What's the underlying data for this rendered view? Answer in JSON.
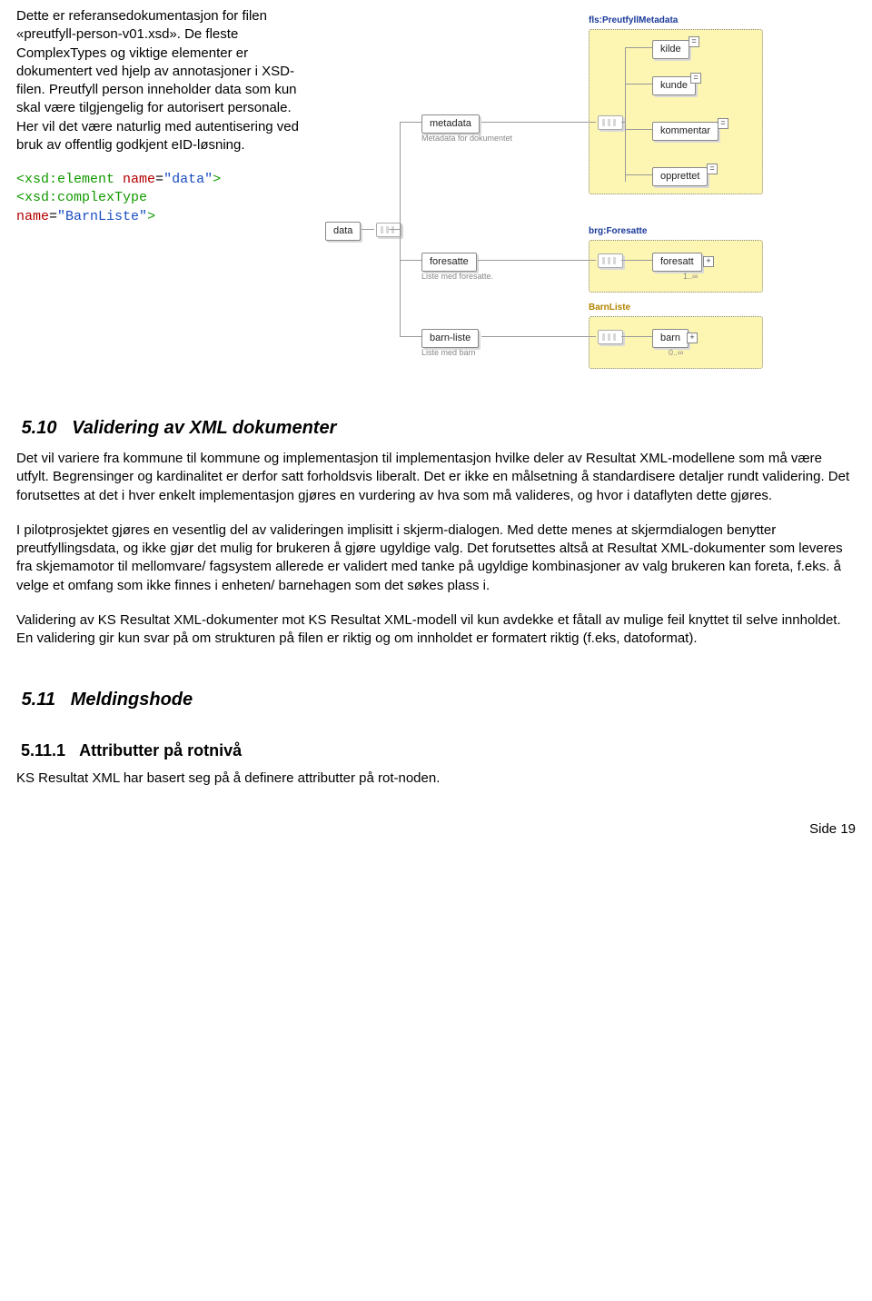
{
  "intro": {
    "p1": "Dette er referansedokumentasjon for filen «preutfyll-person-v01.xsd». De fleste ComplexTypes og viktige elementer er dokumentert ved hjelp av annotasjoner i XSD-filen. Preutfyll person inneholder data som kun skal være tilgjengelig for autorisert personale. Her vil det være naturlig med autentisering ved bruk av offentlig godkjent eID-løsning."
  },
  "code": {
    "line1_el": "<xsd:element",
    "line1_attr": " name",
    "line1_eq": "=",
    "line1_val": "\"data\"",
    "line1_close": ">",
    "line2_el": "<xsd:complexType",
    "line2_attr": "name",
    "line2_eq": "=",
    "line2_val": "\"BarnListe\"",
    "line2_close": ">"
  },
  "diagram": {
    "data": "data",
    "metadata": "metadata",
    "metadata_caption": "Metadata for dokumentet",
    "foresatte": "foresatte",
    "foresatte_caption": "Liste med foresatte.",
    "barnliste": "barn-liste",
    "barnliste_caption": "Liste med barn",
    "group1_title": "fls:PreutfyllMetadata",
    "kilde": "kilde",
    "kunde": "kunde",
    "kommentar": "kommentar",
    "opprettet": "opprettet",
    "group2_title": "brg:Foresatte",
    "foresatt": "foresatt",
    "foresatt_card": "1..∞",
    "group3_title": "BarnListe",
    "barn": "barn",
    "barn_card": "0..∞"
  },
  "sec510": {
    "num": "5.10",
    "title": "Validering av XML dokumenter",
    "p1": "Det vil variere fra kommune til kommune og implementasjon til implementasjon hvilke deler av Resultat XML-modellene som må være utfylt. Begrensinger og kardinalitet er derfor satt forholdsvis liberalt. Det er ikke en målsetning å standardisere detaljer rundt validering. Det forutsettes at det i hver enkelt implementasjon gjøres en vurdering av hva som må valideres, og hvor i dataflyten dette gjøres.",
    "p2": "I pilotprosjektet gjøres en vesentlig del av valideringen implisitt i skjerm-dialogen. Med dette menes at skjermdialogen benytter preutfyllingsdata, og ikke gjør det mulig for brukeren å gjøre ugyldige valg. Det forutsettes altså at Resultat XML-dokumenter som leveres fra skjemamotor til mellomvare/ fagsystem allerede er validert med tanke på ugyldige kombinasjoner av valg brukeren kan foreta, f.eks. å velge et omfang som ikke finnes i enheten/ barnehagen som det søkes plass i.",
    "p3": "Validering av KS Resultat XML-dokumenter mot KS Resultat XML-modell vil kun avdekke et fåtall av mulige feil knyttet til selve innholdet. En validering gir kun svar på om strukturen på filen er riktig og om innholdet er formatert riktig (f.eks, datoformat)."
  },
  "sec511": {
    "num": "5.11",
    "title": "Meldingshode"
  },
  "sec5111": {
    "num": "5.11.1",
    "title": "Attributter på rotnivå",
    "p1": "KS Resultat XML har basert seg på å definere attributter på rot-noden."
  },
  "footer": "Side 19"
}
